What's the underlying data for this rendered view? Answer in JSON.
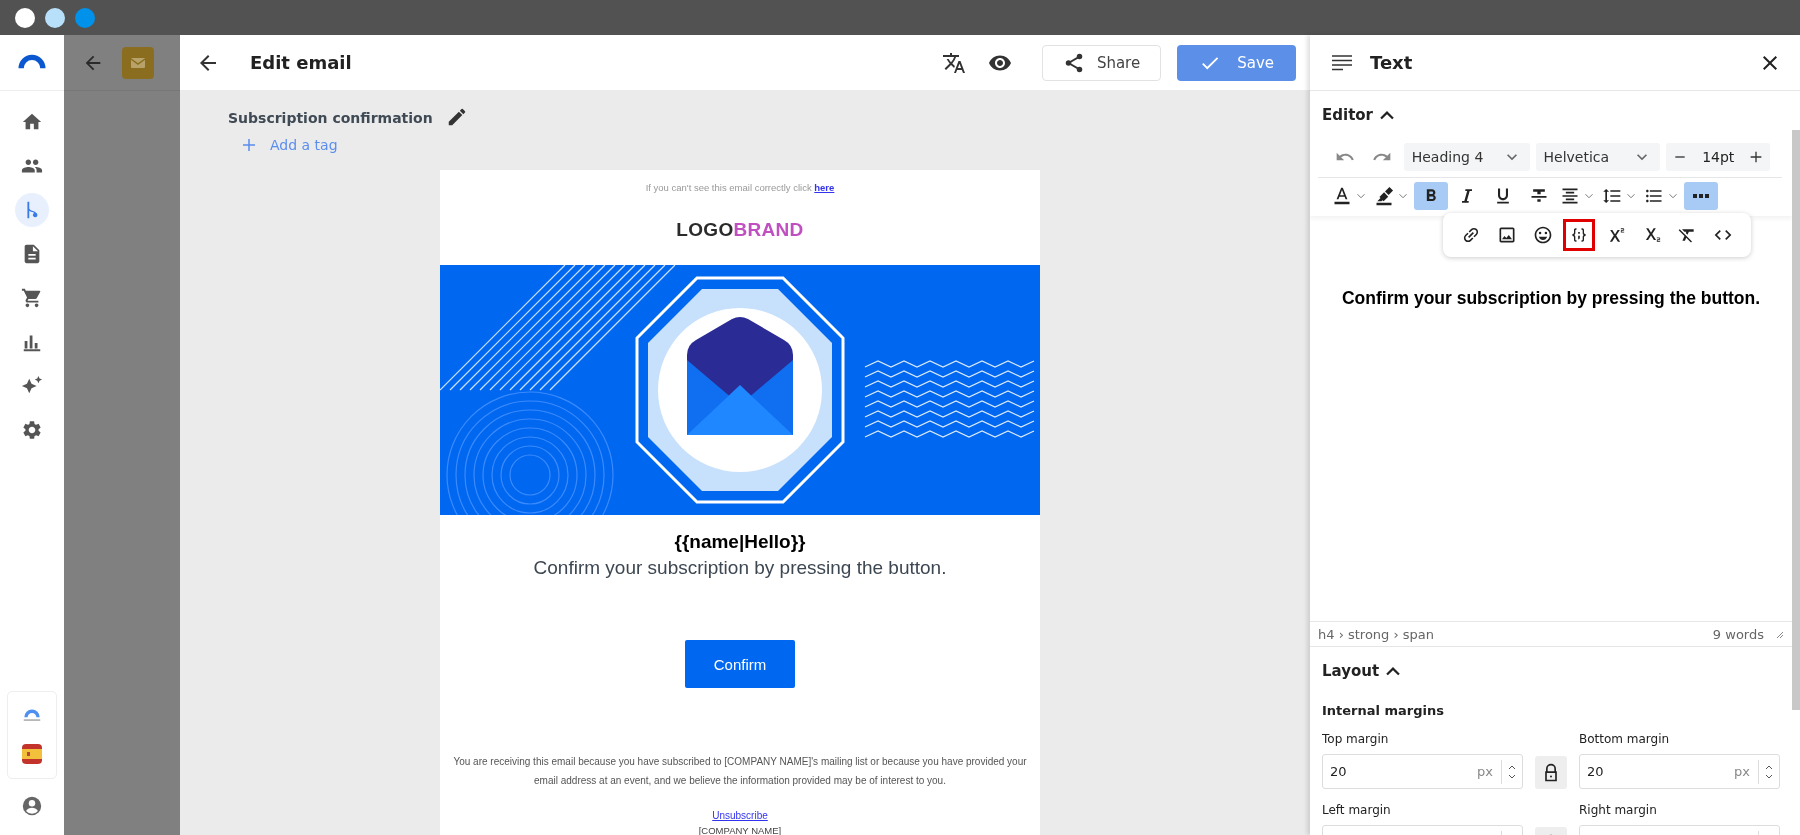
{
  "window_controls": [
    {
      "color": "#ffffff"
    },
    {
      "color": "#b9e0fa"
    },
    {
      "color": "#0091ea"
    }
  ],
  "sidebar": {
    "items": [
      {
        "kind": "home",
        "selected": false
      },
      {
        "kind": "people",
        "selected": false
      },
      {
        "kind": "branch",
        "selected": true
      },
      {
        "kind": "document",
        "selected": false
      },
      {
        "kind": "cart",
        "selected": false
      },
      {
        "kind": "chart",
        "selected": false
      },
      {
        "kind": "sparkle",
        "selected": false
      },
      {
        "kind": "gear",
        "selected": false
      }
    ]
  },
  "editor": {
    "title": "Edit email",
    "share": "Share",
    "save": "Save",
    "email_name": "Subscription confirmation",
    "add_tag": "Add a tag"
  },
  "email": {
    "preheader": "If you can't see this email correctly click",
    "preheader_link": "here",
    "logo_dark": "LOGO",
    "logo_accent": "BRAND",
    "greeting": "{{name|Hello}}",
    "body": "Confirm your subscription by pressing the button.",
    "button": "Confirm",
    "footer": "You are receiving this email because you have subscribed to [COMPANY NAME]'s mailing list or because you have provided your email address at an event, and we believe the information provided may be of interest to you.",
    "unsubscribe": "Unsubscribe",
    "company": "[COMPANY NAME]"
  },
  "panel": {
    "title": "Text",
    "editor_section": {
      "title": "Editor",
      "expanded": true
    },
    "block_type": "Heading 4",
    "font": "Helvetica",
    "font_size": "14pt",
    "tools": [
      {
        "kind": "text-color",
        "selected": false,
        "menu": true
      },
      {
        "kind": "highlight",
        "selected": false,
        "menu": true
      },
      {
        "kind": "bold",
        "selected": true,
        "menu": false
      },
      {
        "kind": "italic",
        "selected": false,
        "menu": false
      },
      {
        "kind": "underline",
        "selected": false,
        "menu": false
      },
      {
        "kind": "strike",
        "selected": false,
        "menu": false
      },
      {
        "kind": "align",
        "selected": false,
        "menu": true
      },
      {
        "kind": "line-height",
        "selected": false,
        "menu": true
      },
      {
        "kind": "list",
        "selected": false,
        "menu": true
      },
      {
        "kind": "more",
        "selected": true,
        "menu": false
      }
    ],
    "more_tools": [
      {
        "kind": "link",
        "highlighted": false
      },
      {
        "kind": "image",
        "highlighted": false
      },
      {
        "kind": "emoji",
        "highlighted": false
      },
      {
        "kind": "variable",
        "highlighted": true
      },
      {
        "kind": "superscript",
        "highlighted": false
      },
      {
        "kind": "subscript",
        "highlighted": false
      },
      {
        "kind": "clear-format",
        "highlighted": false
      },
      {
        "kind": "code",
        "highlighted": false
      }
    ],
    "content": "Confirm your subscription by pressing the button.",
    "path": "h4 › strong › span",
    "word_count": "9 words",
    "layout_section": {
      "title": "Layout",
      "expanded": true
    },
    "margins_title": "Internal margins",
    "margins": [
      {
        "label": "Top margin",
        "value": "20",
        "unit": "px"
      },
      {
        "label": "Bottom margin",
        "value": "20",
        "unit": "px"
      },
      {
        "label": "Left margin"
      },
      {
        "label": "Right margin"
      }
    ]
  }
}
